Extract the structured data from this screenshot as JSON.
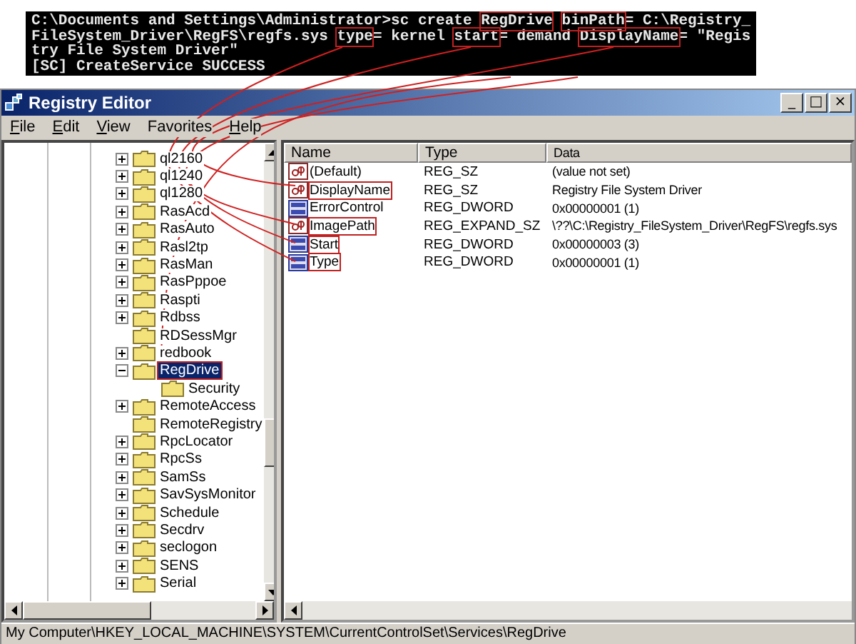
{
  "console": {
    "lines": [
      [
        {
          "text": "C:\\Documents and Settings\\Administrator>sc create ",
          "highlighted": false
        },
        {
          "text": "RegDrive",
          "highlighted": true
        },
        {
          "text": "binPath",
          "highlighted": true
        },
        {
          "text": "= C:\\Registry_",
          "highlighted": false
        }
      ],
      [
        {
          "text": "FileSystem_Driver\\RegFS\\regfs.sys ",
          "highlighted": false
        },
        {
          "text": "type",
          "highlighted": true
        },
        {
          "text": "= kernel ",
          "highlighted": false
        },
        {
          "text": "start",
          "highlighted": true
        },
        {
          "text": "= demand ",
          "highlighted": false
        },
        {
          "text": "DisplayName",
          "highlighted": true
        },
        {
          "text": "= \"Regis",
          "highlighted": false
        }
      ],
      [
        {
          "text": "try File System Driver\"",
          "highlighted": false
        }
      ],
      [
        {
          "text": "[SC] CreateService SUCCESS",
          "highlighted": false
        }
      ]
    ]
  },
  "window": {
    "title": "Registry Editor",
    "controls": [
      "_",
      "□",
      "×"
    ]
  },
  "menu": [
    {
      "label": "File",
      "underlined": true
    },
    {
      "label": "Edit",
      "underlined": true
    },
    {
      "label": "View",
      "underlined": true
    },
    {
      "label": "Favorites",
      "underlined": false
    },
    {
      "label": "Help",
      "underlined": true
    }
  ],
  "tree": {
    "items": [
      {
        "label": "ql2160",
        "has_children": true,
        "expanded": false,
        "selected": false
      },
      {
        "label": "ql1240",
        "has_children": true,
        "expanded": false,
        "selected": false
      },
      {
        "label": "ql1280",
        "has_children": true,
        "expanded": false,
        "selected": false
      },
      {
        "label": "RasAcd",
        "has_children": true,
        "expanded": false,
        "selected": false
      },
      {
        "label": "RasAuto",
        "has_children": true,
        "expanded": false,
        "selected": false
      },
      {
        "label": "Rasl2tp",
        "has_children": true,
        "expanded": false,
        "selected": false
      },
      {
        "label": "RasMan",
        "has_children": true,
        "expanded": false,
        "selected": false
      },
      {
        "label": "RasPppoe",
        "has_children": true,
        "expanded": false,
        "selected": false
      },
      {
        "label": "Raspti",
        "has_children": true,
        "expanded": false,
        "selected": false
      },
      {
        "label": "Rdbss",
        "has_children": true,
        "expanded": false,
        "selected": false
      },
      {
        "label": "RDSessMgr",
        "has_children": false,
        "selected": false
      },
      {
        "label": "redbook",
        "has_children": true,
        "expanded": false,
        "selected": false
      },
      {
        "label": "RegDrive",
        "has_children": true,
        "expanded": true,
        "selected": true,
        "children": [
          {
            "label": "Security",
            "has_children": false,
            "selected": false
          }
        ]
      },
      {
        "label": "RemoteAccess",
        "has_children": true,
        "expanded": false,
        "selected": false
      },
      {
        "label": "RemoteRegistry",
        "has_children": false,
        "selected": false
      },
      {
        "label": "RpcLocator",
        "has_children": true,
        "expanded": false,
        "selected": false
      },
      {
        "label": "RpcSs",
        "has_children": true,
        "expanded": false,
        "selected": false
      },
      {
        "label": "SamSs",
        "has_children": true,
        "expanded": false,
        "selected": false
      },
      {
        "label": "SavSysMonitor",
        "has_children": true,
        "expanded": false,
        "selected": false
      },
      {
        "label": "Schedule",
        "has_children": true,
        "expanded": false,
        "selected": false
      },
      {
        "label": "Secdrv",
        "has_children": true,
        "expanded": false,
        "selected": false
      },
      {
        "label": "seclogon",
        "has_children": true,
        "expanded": false,
        "selected": false
      },
      {
        "label": "SENS",
        "has_children": true,
        "expanded": false,
        "selected": false
      },
      {
        "label": "Serial",
        "has_children": true,
        "expanded": false,
        "selected": false
      }
    ]
  },
  "values": {
    "columns": [
      "Name",
      "Type",
      "Data"
    ],
    "rows": [
      {
        "kind": "string",
        "name": "(Default)",
        "type": "REG_SZ",
        "data": "(value not set)",
        "highlighted": false
      },
      {
        "kind": "string",
        "name": "DisplayName",
        "type": "REG_SZ",
        "data": "Registry File System Driver",
        "highlighted": true
      },
      {
        "kind": "dword",
        "name": "ErrorControl",
        "type": "REG_DWORD",
        "data": "0x00000001 (1)",
        "highlighted": false
      },
      {
        "kind": "string",
        "name": "ImagePath",
        "type": "REG_EXPAND_SZ",
        "data": "\\??\\C:\\Registry_FileSystem_Driver\\RegFS\\regfs.sys",
        "highlighted": true
      },
      {
        "kind": "dword",
        "name": "Start",
        "type": "REG_DWORD",
        "data": "0x00000003 (3)",
        "highlighted": true
      },
      {
        "kind": "dword",
        "name": "Type",
        "type": "REG_DWORD",
        "data": "0x00000001 (1)",
        "highlighted": true
      }
    ]
  },
  "status_bar": "My Computer\\HKEY_LOCAL_MACHINE\\SYSTEM\\CurrentControlSet\\Services\\RegDrive"
}
